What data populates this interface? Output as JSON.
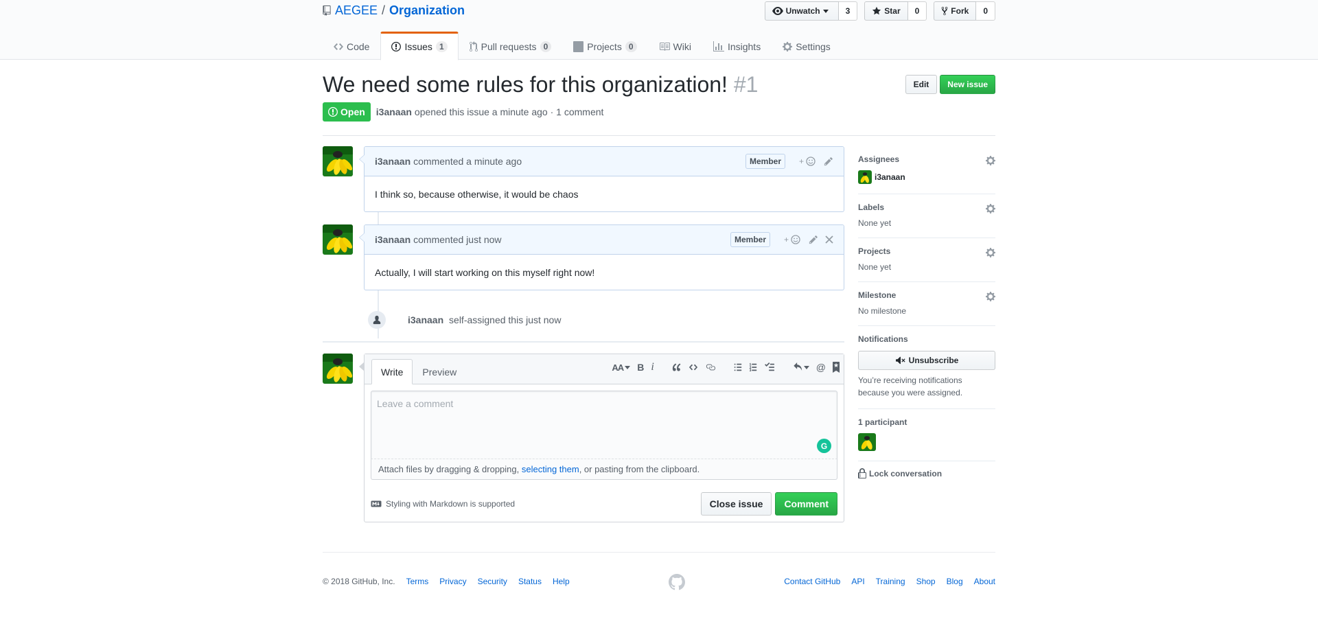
{
  "repo": {
    "owner": "AEGEE",
    "separator": "/",
    "name": "Organization",
    "actions": {
      "watch_label": "Unwatch",
      "watch_count": "3",
      "star_label": "Star",
      "star_count": "0",
      "fork_label": "Fork",
      "fork_count": "0"
    },
    "nav": [
      {
        "label": "Code",
        "counter": null
      },
      {
        "label": "Issues",
        "counter": "1"
      },
      {
        "label": "Pull requests",
        "counter": "0"
      },
      {
        "label": "Projects",
        "counter": "0"
      },
      {
        "label": "Wiki",
        "counter": null
      },
      {
        "label": "Insights",
        "counter": null
      },
      {
        "label": "Settings",
        "counter": null
      }
    ]
  },
  "issue": {
    "title": "We need some rules for this organization!",
    "number": "#1",
    "edit_label": "Edit",
    "new_issue_label": "New issue",
    "state": "Open",
    "author": "i3anaan",
    "meta_text": "opened this issue a minute ago · 1 comment"
  },
  "comments": [
    {
      "author": "i3anaan",
      "action": "commented a minute ago",
      "badge": "Member",
      "body": "I think so, because otherwise, it would be chaos"
    },
    {
      "author": "i3anaan",
      "action": "commented just now",
      "badge": "Member",
      "body": "Actually, I will start working on this myself right now!"
    }
  ],
  "event": {
    "author": "i3anaan",
    "text": "self-assigned this just now"
  },
  "new_comment": {
    "tab_write": "Write",
    "tab_preview": "Preview",
    "placeholder": "Leave a comment",
    "grammarly": "G",
    "attach_prefix": "Attach files by dragging & dropping, ",
    "attach_link": "selecting them",
    "attach_suffix": ", or pasting from the clipboard.",
    "markdown_hint": "Styling with Markdown is supported",
    "close_label": "Close issue",
    "comment_label": "Comment",
    "toolbar": {
      "header": "AA",
      "bold": "B",
      "italic": "i",
      "mention": "@"
    }
  },
  "sidebar": {
    "assignees_heading": "Assignees",
    "assignee_name": "i3anaan",
    "labels_heading": "Labels",
    "labels_value": "None yet",
    "projects_heading": "Projects",
    "projects_value": "None yet",
    "milestone_heading": "Milestone",
    "milestone_value": "No milestone",
    "notifications_heading": "Notifications",
    "unsubscribe_label": "Unsubscribe",
    "notification_reason": "You’re receiving notifications because you were assigned.",
    "participants_heading": "1 participant",
    "lock_label": "Lock conversation"
  },
  "footer": {
    "copyright": "© 2018 GitHub, Inc.",
    "left_links": [
      "Terms",
      "Privacy",
      "Security",
      "Status",
      "Help"
    ],
    "right_links": [
      "Contact GitHub",
      "API",
      "Training",
      "Shop",
      "Blog",
      "About"
    ]
  },
  "colors": {
    "link": "#0366d6",
    "open_state": "#2cbe4e",
    "primary_button": "#28a745",
    "selected_tab_accent": "#e36209",
    "comment_header": "#f1f8ff"
  }
}
